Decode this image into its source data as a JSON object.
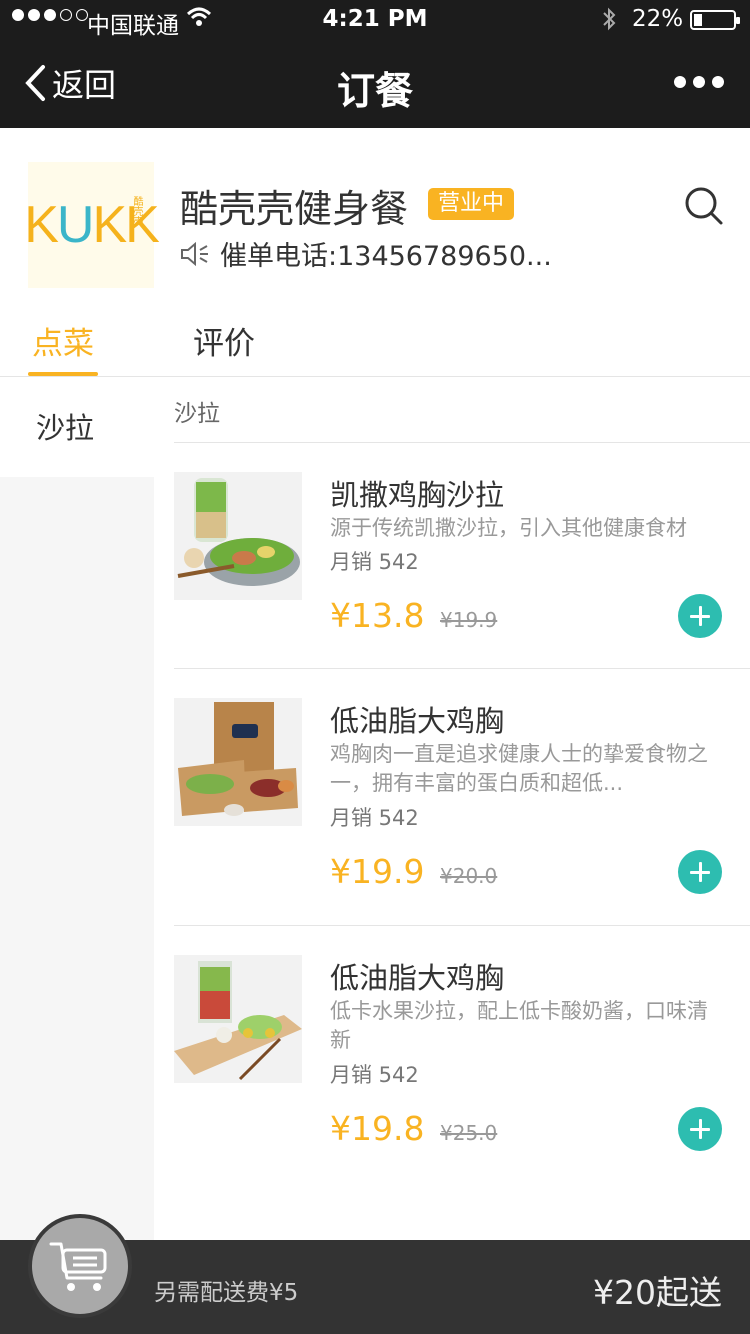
{
  "status_bar": {
    "carrier": "中国联通",
    "time": "4:21 PM",
    "battery": "22%",
    "battery_level": 0.22
  },
  "nav": {
    "back_label": "返回",
    "title": "订餐"
  },
  "shop": {
    "logo_text": "KUKK",
    "logo_side_text": "酷壳壳",
    "name": "酷壳壳健身餐",
    "status_badge": "营业中",
    "phone_line": "催单电话:13456789650..."
  },
  "tabs": [
    {
      "label": "点菜",
      "active": true
    },
    {
      "label": "评价",
      "active": false
    }
  ],
  "categories": [
    {
      "label": "沙拉",
      "selected": true
    }
  ],
  "section": {
    "title": "沙拉"
  },
  "items": [
    {
      "name": "凯撒鸡胸沙拉",
      "desc": "源于传统凯撒沙拉，引入其他健康食材",
      "sales": "月销 542",
      "price": "¥13.8",
      "old_price": "¥19.9"
    },
    {
      "name": "低油脂大鸡胸",
      "desc": "鸡胸肉一直是追求健康人士的挚爱食物之一，拥有丰富的蛋白质和超低...",
      "sales": "月销 542",
      "price": "¥19.9",
      "old_price": "¥20.0"
    },
    {
      "name": "低油脂大鸡胸",
      "desc": "低卡水果沙拉，配上低卡酸奶酱，口味清新",
      "sales": "月销 542",
      "price": "¥19.8",
      "old_price": "¥25.0"
    }
  ],
  "bottom_bar": {
    "delivery_fee": "另需配送费¥5",
    "min_order": "¥20起送"
  },
  "colors": {
    "accent": "#f9b322",
    "add_button": "#2dbdb0",
    "header_bg": "#1c1c1c",
    "bottom_bg": "#333333"
  },
  "icons": [
    "back-chevron-icon",
    "more-dots-icon",
    "search-icon",
    "speaker-icon",
    "plus-icon",
    "cart-icon",
    "wifi-icon",
    "bluetooth-icon",
    "battery-icon"
  ]
}
